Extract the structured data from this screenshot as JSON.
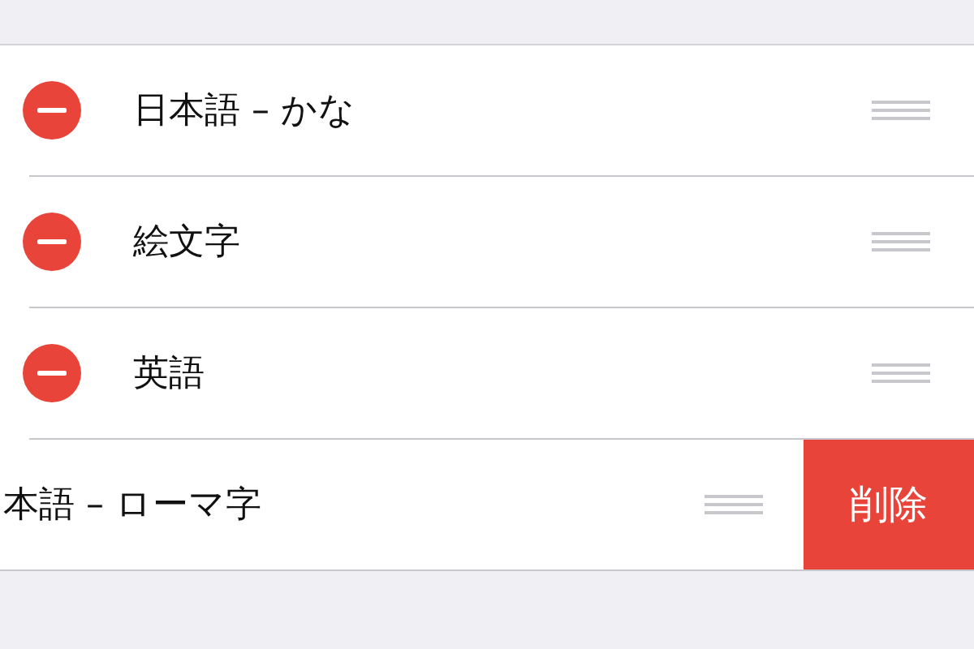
{
  "rows": [
    {
      "kind": "editing",
      "label": "日本語 – かな"
    },
    {
      "kind": "editing",
      "label": "絵文字"
    },
    {
      "kind": "editing",
      "label": "英語"
    },
    {
      "kind": "swiped",
      "label": "本語 – ローマ字",
      "action": "削除"
    }
  ]
}
